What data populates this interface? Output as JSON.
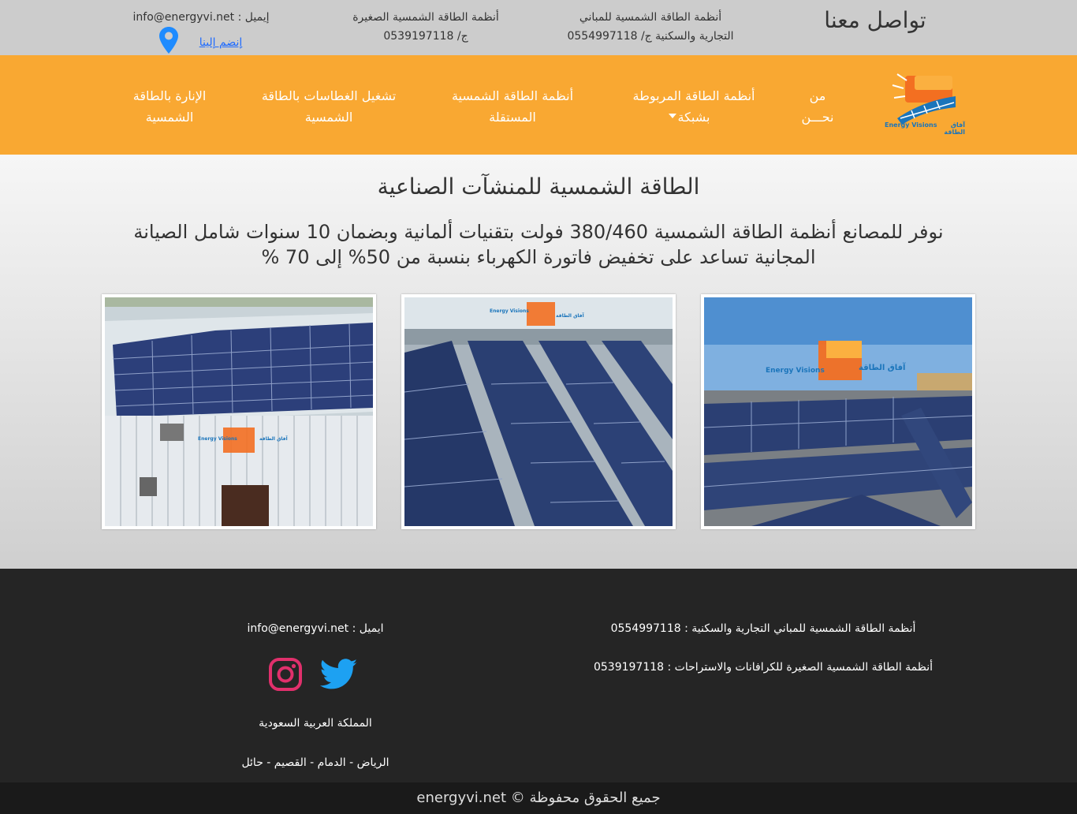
{
  "topbar": {
    "contact_title": "تواصل معنا",
    "buildings_line1": "أنظمة الطاقة الشمسية للمباني",
    "buildings_line2": "التجارية والسكنية ج/ 0554997118",
    "small_line1": "أنظمة الطاقة الشمسية الصغيرة",
    "small_line2": "ج/ 0539197118",
    "email": "إيميل : info@energyvi.net",
    "join_us": "إنضم إلينا"
  },
  "nav": {
    "logo_en": "Energy Visions",
    "logo_ar": "آفاق الطاقة",
    "items": [
      {
        "label": "من\nنحـــن"
      },
      {
        "label": "أنظمة الطاقة المربوطة\nبشبكة"
      },
      {
        "label": "أنظمة الطاقة الشمسية\nالمستقلة"
      },
      {
        "label": "تشغيل الغطاسات بالطاقة\nالشمسية"
      },
      {
        "label": "الإنارة بالطاقة\nالشمسية"
      }
    ]
  },
  "hero": {
    "title": "الطاقة الشمسية للمنشآت الصناعية",
    "subtitle": "نوفر للمصانع أنظمة الطاقة الشمسية 380/460 فولت بتقنيات ألمانية وبضمان 10 سنوات شامل الصيانة المجانية تساعد على تخفيض فاتورة الكهرباء بنسبة من 50% إلى 70 %"
  },
  "photos": [
    {
      "logo_en": "Energy Visions",
      "logo_ar": "آفاق الطاقة"
    },
    {
      "logo_en": "Energy Visions",
      "logo_ar": "آفاق الطاقة"
    },
    {
      "logo_en": "Energy Visions",
      "logo_ar": "آفاق الطاقة"
    }
  ],
  "footer": {
    "buildings": "أنظمة الطاقة الشمسية للمباني التجارية والسكنية : 0554997118",
    "small": "أنظمة الطاقة الشمسية الصغيرة للكرافانات والاستراحات : 0539197118",
    "email": "ايميل : info@energyvi.net",
    "country": "المملكة العربية السعودية",
    "cities": "الرياض - الدمام - القصيم - حائل",
    "copyright": "جميع الحقوق محفوظة © energyvi.net"
  },
  "colors": {
    "accent": "#f9a832",
    "twitter": "#1da1f2",
    "instagram": "#e1306c",
    "pin": "#1e8bff"
  },
  "icons": [
    "location-pin-icon",
    "twitter-icon",
    "instagram-icon"
  ]
}
